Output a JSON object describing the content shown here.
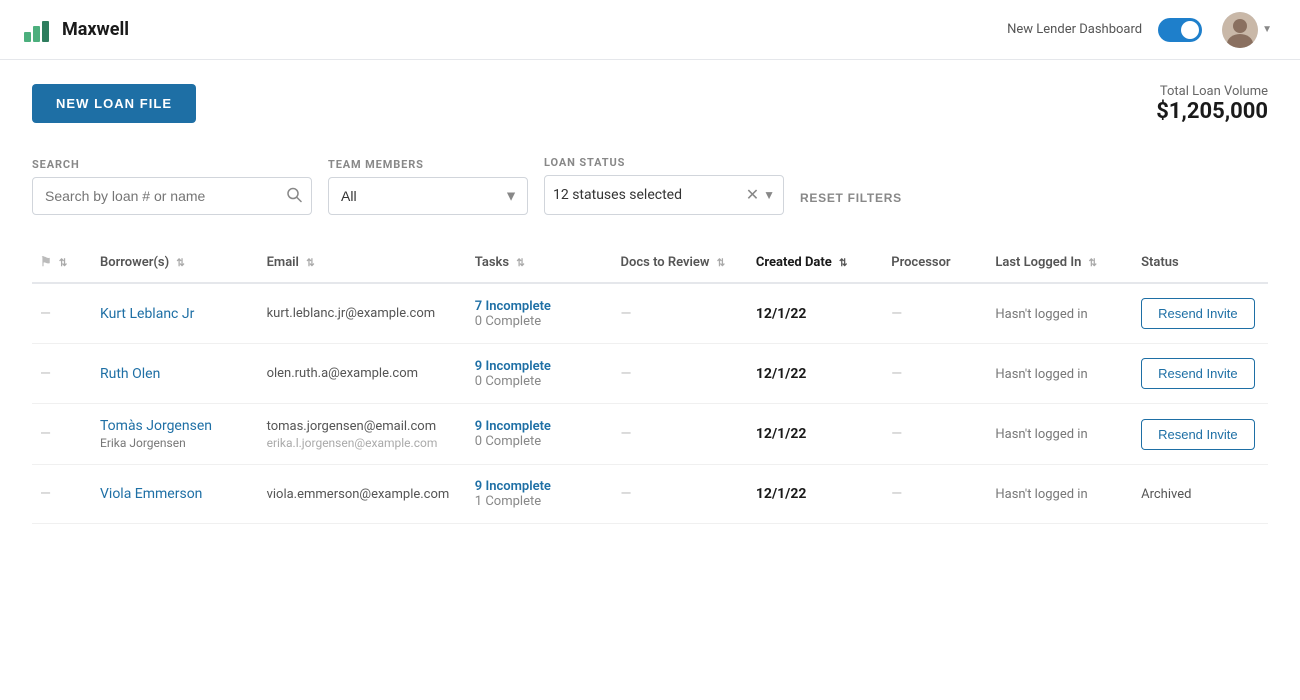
{
  "header": {
    "logo_text": "Maxwell",
    "toggle_label": "New Lender Dashboard",
    "toggle_on": true
  },
  "toolbar": {
    "new_loan_button": "NEW LOAN FILE",
    "total_label": "Total Loan Volume",
    "total_amount": "$1,205,000"
  },
  "filters": {
    "search_label": "SEARCH",
    "search_placeholder": "Search by loan # or name",
    "team_label": "TEAM MEMBERS",
    "team_value": "All",
    "status_label": "LOAN STATUS",
    "status_value": "12 statuses selected",
    "reset_label": "RESET FILTERS"
  },
  "table": {
    "columns": [
      {
        "id": "flag",
        "label": ""
      },
      {
        "id": "borrower",
        "label": "Borrower(s)",
        "sortable": true
      },
      {
        "id": "email",
        "label": "Email",
        "sortable": true
      },
      {
        "id": "tasks",
        "label": "Tasks",
        "sortable": true
      },
      {
        "id": "docs",
        "label": "Docs to Review",
        "sortable": true
      },
      {
        "id": "date",
        "label": "Created Date",
        "sortable": true,
        "active": true
      },
      {
        "id": "processor",
        "label": "Processor"
      },
      {
        "id": "lastlogged",
        "label": "Last Logged In",
        "sortable": true
      },
      {
        "id": "status",
        "label": "Status"
      }
    ],
    "rows": [
      {
        "id": "row1",
        "flag": "—",
        "borrower_name": "Kurt Leblanc Jr",
        "borrower_sub": "",
        "email": "kurt.leblanc.jr@example.com",
        "email_sub": "",
        "tasks_incomplete": "7 Incomplete",
        "tasks_complete": "0 Complete",
        "docs": "—",
        "date": "12/1/22",
        "processor": "",
        "last_logged": "Hasn't logged in",
        "status": "resend",
        "status_label": "Resend Invite"
      },
      {
        "id": "row2",
        "flag": "—",
        "borrower_name": "Ruth Olen",
        "borrower_sub": "",
        "email": "olen.ruth.a@example.com",
        "email_sub": "",
        "tasks_incomplete": "9 Incomplete",
        "tasks_complete": "0 Complete",
        "docs": "—",
        "date": "12/1/22",
        "processor": "",
        "last_logged": "Hasn't logged in",
        "status": "resend",
        "status_label": "Resend Invite"
      },
      {
        "id": "row3",
        "flag": "—",
        "borrower_name": "Tomàs Jorgensen",
        "borrower_sub": "Erika Jorgensen",
        "email": "tomas.jorgensen@email.com",
        "email_sub": "erika.l.jorgensen@example.com",
        "tasks_incomplete": "9 Incomplete",
        "tasks_complete": "0 Complete",
        "docs": "—",
        "date": "12/1/22",
        "processor": "",
        "last_logged": "Hasn't logged in",
        "status": "resend",
        "status_label": "Resend Invite"
      },
      {
        "id": "row4",
        "flag": "—",
        "borrower_name": "Viola Emmerson",
        "borrower_sub": "",
        "email": "viola.emmerson@example.com",
        "email_sub": "",
        "tasks_incomplete": "9 Incomplete",
        "tasks_complete": "1 Complete",
        "docs": "—",
        "date": "12/1/22",
        "processor": "",
        "last_logged": "Hasn't logged in",
        "status": "archived",
        "status_label": "Archived"
      }
    ]
  }
}
